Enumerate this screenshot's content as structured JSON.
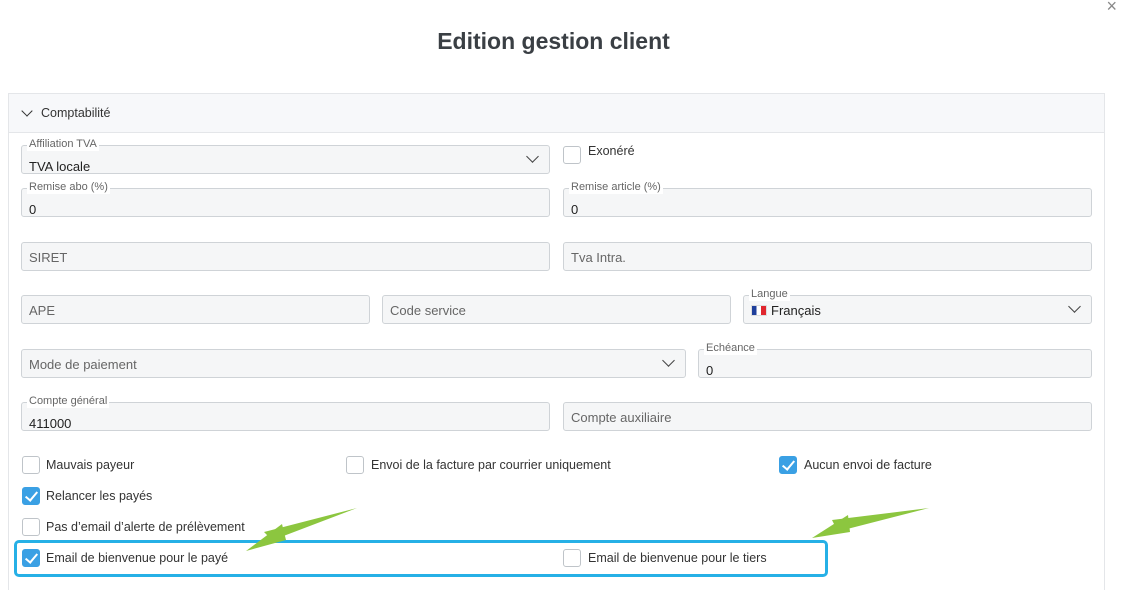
{
  "modal": {
    "title": "Edition gestion client",
    "close_glyph": "×"
  },
  "section": {
    "title": "Comptabilité"
  },
  "fields": {
    "affiliation_tva": {
      "label": "Affiliation TVA",
      "value": "TVA locale"
    },
    "remise_abo": {
      "label": "Remise abo (%)",
      "value": "0"
    },
    "remise_article": {
      "label": "Remise article (%)",
      "value": "0"
    },
    "siret": {
      "placeholder": "SIRET"
    },
    "tva_intra": {
      "placeholder": "Tva Intra."
    },
    "ape": {
      "placeholder": "APE"
    },
    "code_service": {
      "placeholder": "Code service"
    },
    "langue": {
      "label": "Langue",
      "value": "Français"
    },
    "mode_paiement": {
      "placeholder": "Mode de paiement"
    },
    "echeance": {
      "label": "Echéance",
      "value": "0"
    },
    "compte_general": {
      "label": "Compte général",
      "value": "411000"
    },
    "compte_auxiliaire": {
      "placeholder": "Compte auxiliaire"
    }
  },
  "checkboxes": {
    "exonere": {
      "label": "Exonéré",
      "checked": false
    },
    "mauvais_payeur": {
      "label": "Mauvais payeur",
      "checked": false
    },
    "envoi_courrier": {
      "label": "Envoi de la facture par courrier uniquement",
      "checked": false
    },
    "aucun_envoi": {
      "label": "Aucun envoi de facture",
      "checked": true
    },
    "relancer": {
      "label": "Relancer les payés",
      "checked": true
    },
    "pas_email": {
      "label": "Pas d’email d’alerte de prélèvement",
      "checked": false
    },
    "email_paye": {
      "label": "Email de bienvenue pour le payé",
      "checked": true
    },
    "email_tiers": {
      "label": "Email de bienvenue pour le tiers",
      "checked": false
    }
  },
  "annotation": {
    "highlight_color": "#26b0e6",
    "arrow_color": "#8cc63f"
  }
}
